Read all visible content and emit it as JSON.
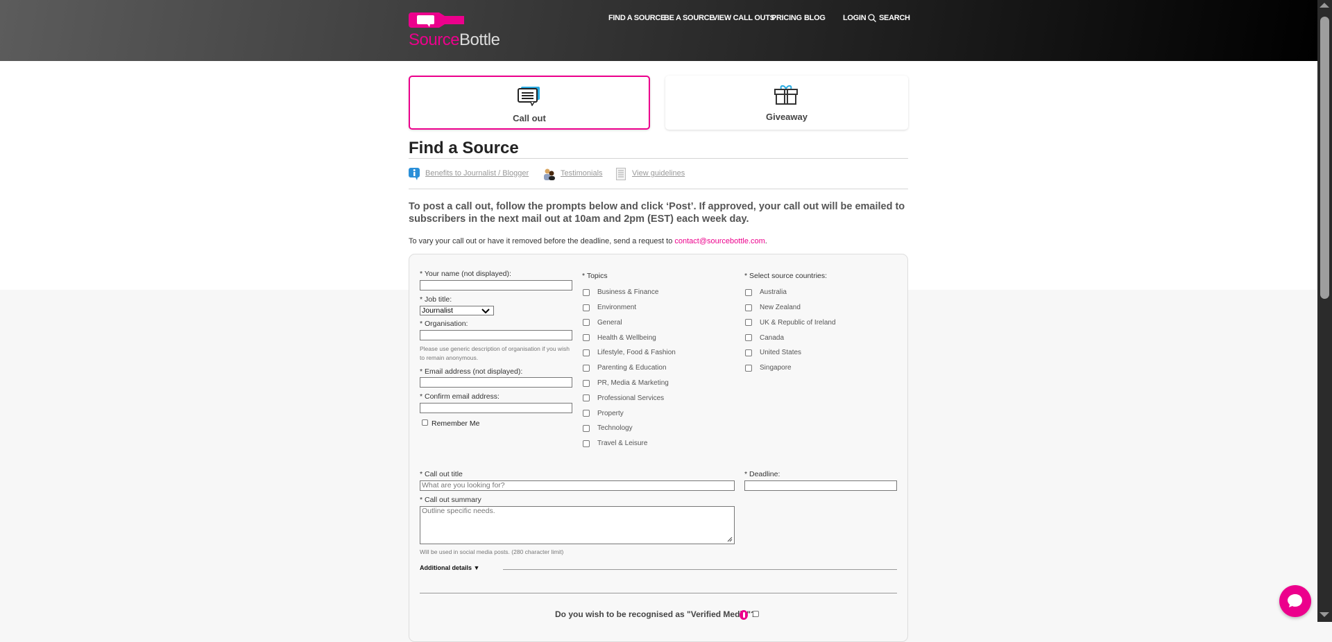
{
  "brand": {
    "name_part1": "Source",
    "name_part2": "Bottle",
    "pink": "#ec008c"
  },
  "nav": {
    "items": [
      "FIND A SOURCE",
      "BE A SOURCE",
      "VIEW CALL OUTS",
      "PRICING",
      "BLOG"
    ],
    "login": "LOGIN",
    "search": "SEARCH"
  },
  "cards": [
    {
      "label": "Call out",
      "icon": "speech-bubble-icon",
      "selected": true
    },
    {
      "label": "Giveaway",
      "icon": "gift-icon",
      "selected": false
    }
  ],
  "page": {
    "title": "Find a Source",
    "links": [
      "Benefits to Journalist / Blogger",
      "Testimonials",
      "View guidelines"
    ],
    "intro": "To post a call out, follow the prompts below and click ‘Post’. If approved, your call out will be emailed to subscribers in the next mail out at 10am and 2pm (EST) each week day.",
    "vary_text": "To vary your call out or have it removed before the deadline, send a request to ",
    "email": "contact@sourcebottle.com",
    "period": "."
  },
  "form": {
    "name_label": "* Your name (not displayed):",
    "job_label": "* Job title:",
    "job_value": "Journalist",
    "org_label": "* Organisation:",
    "org_hint": "Please use generic description of organisation if you wish to remain anonymous.",
    "email_label": "* Email address (not displayed):",
    "confirm_label": "* Confirm email address:",
    "remember": "Remember Me",
    "topics_label": "* Topics",
    "topics": [
      "Business & Finance",
      "Environment",
      "General",
      "Health & Wellbeing",
      "Lifestyle, Food & Fashion",
      "Parenting & Education",
      "PR, Media & Marketing",
      "Professional Services",
      "Property",
      "Technology",
      "Travel & Leisure"
    ],
    "countries_label": "* Select source countries:",
    "countries": [
      "Australia",
      "New Zealand",
      "UK & Republic of Ireland",
      "Canada",
      "United States",
      "Singapore"
    ],
    "title_label": "* Call out title",
    "title_placeholder": "What are you looking for?",
    "deadline_label": "* Deadline:",
    "summary_label": "* Call out summary",
    "summary_placeholder": "Outline specific needs.",
    "summary_hint": "Will be used in social media posts. (280 character limit)",
    "additional": "Additional details",
    "verified": "Do you wish to be recognised as \"Verified Media\"?"
  }
}
